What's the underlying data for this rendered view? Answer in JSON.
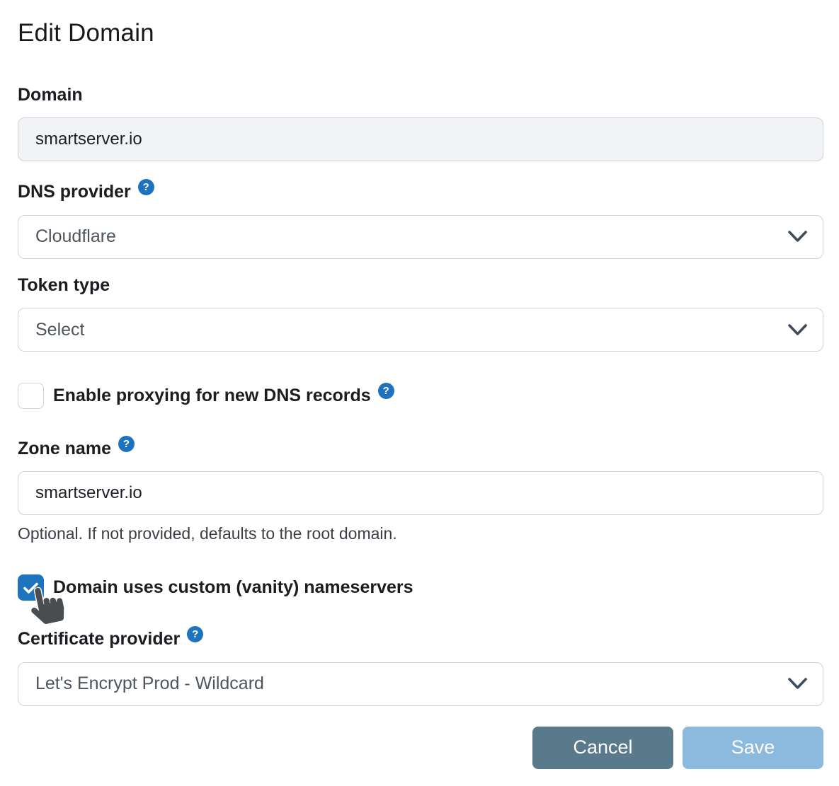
{
  "title": "Edit Domain",
  "icons": {
    "help_glyph": "?"
  },
  "colors": {
    "accent_blue": "#1e73be",
    "cancel_button_bg": "#587a8a",
    "save_button_bg": "#8cbade",
    "disabled_input_bg": "#f1f3f4"
  },
  "form": {
    "domain": {
      "label": "Domain",
      "value": "smartserver.io",
      "disabled": true
    },
    "dns_provider": {
      "label": "DNS provider",
      "value": "Cloudflare"
    },
    "token_type": {
      "label": "Token type",
      "value": "Select"
    },
    "proxy_checkbox": {
      "label": "Enable proxying for new DNS records",
      "checked": false
    },
    "zone_name": {
      "label": "Zone name",
      "value": "smartserver.io",
      "helper": "Optional. If not provided, defaults to the root domain."
    },
    "vanity_checkbox": {
      "label": "Domain uses custom (vanity) nameservers",
      "checked": true
    },
    "certificate_provider": {
      "label": "Certificate provider",
      "value": "Let's Encrypt Prod - Wildcard"
    }
  },
  "actions": {
    "cancel_label": "Cancel",
    "save_label": "Save"
  }
}
